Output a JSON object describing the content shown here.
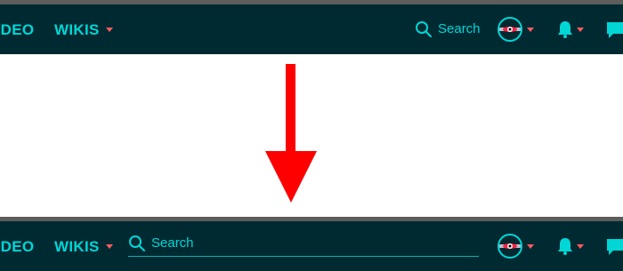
{
  "top_bar": {
    "video_label": "VIDEO",
    "wikis_label": "WIKIS",
    "search_label": "Search"
  },
  "bottom_bar": {
    "video_label": "VIDEO",
    "wikis_label": "WIKIS",
    "search_placeholder": "Search"
  },
  "colors": {
    "nav_bg": "#002a32",
    "accent": "#00d6d6",
    "caret": "#ff5a5f",
    "arrow": "#ff0000",
    "divider": "#5d5d5d"
  },
  "icons": [
    "search-icon",
    "avatar-icon",
    "bell-icon",
    "chat-icon",
    "down-arrow-icon"
  ]
}
